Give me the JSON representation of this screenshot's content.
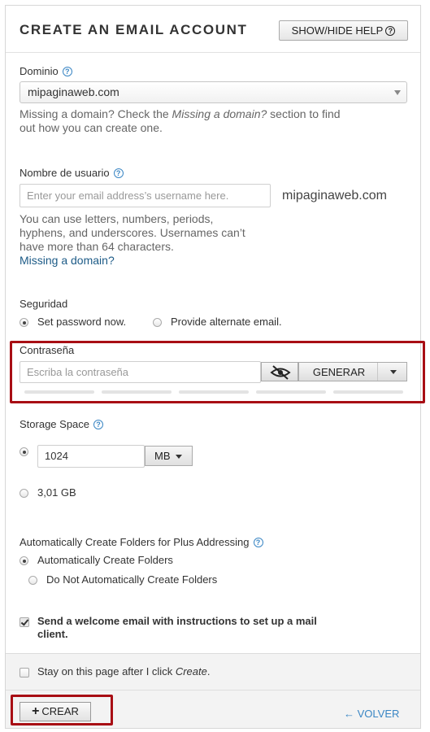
{
  "header": {
    "title": "CREATE AN EMAIL ACCOUNT",
    "help_button": "SHOW/HIDE HELP"
  },
  "domain": {
    "label": "Dominio",
    "selected": "mipaginaweb.com",
    "note_line1_prefix": "Missing a domain? Check the ",
    "note_line1_em": "Missing a domain?",
    "note_line1_suffix": " section to find",
    "note_line2": "out how you can create one."
  },
  "username": {
    "label": "Nombre de usuario",
    "placeholder": "Enter your email address’s username here.",
    "domain_suffix": "mipaginaweb.com",
    "note_line1": "You can use letters, numbers, periods,",
    "note_line2": "hyphens, and underscores. Usernames can’t",
    "note_line3": "have more than 64 characters.",
    "link": "Missing a domain?"
  },
  "security": {
    "label": "Seguridad",
    "option_set": "Set password now.",
    "option_alt": "Provide alternate email."
  },
  "password": {
    "label": "Contraseña",
    "placeholder": "Escriba la contraseña",
    "generate_label": "GENERAR"
  },
  "storage": {
    "label": "Storage Space",
    "value": "1024",
    "unit": "MB",
    "unlimited_option": "3,01 GB"
  },
  "folders": {
    "label": "Automatically Create Folders for Plus Addressing",
    "option_auto": "Automatically Create Folders",
    "option_none": "Do Not Automatically Create Folders"
  },
  "welcome": {
    "line1": "Send a welcome email with instructions to set up a mail",
    "line2": "client."
  },
  "footer": {
    "stay_prefix": "Stay on this page after I click ",
    "stay_em": "Create",
    "stay_suffix": ".",
    "create_button": "CREAR",
    "back_link": "VOLVER"
  },
  "colors": {
    "highlight": "#a80e14",
    "link": "#1d5b87",
    "accent_blue": "#3a86c4"
  }
}
